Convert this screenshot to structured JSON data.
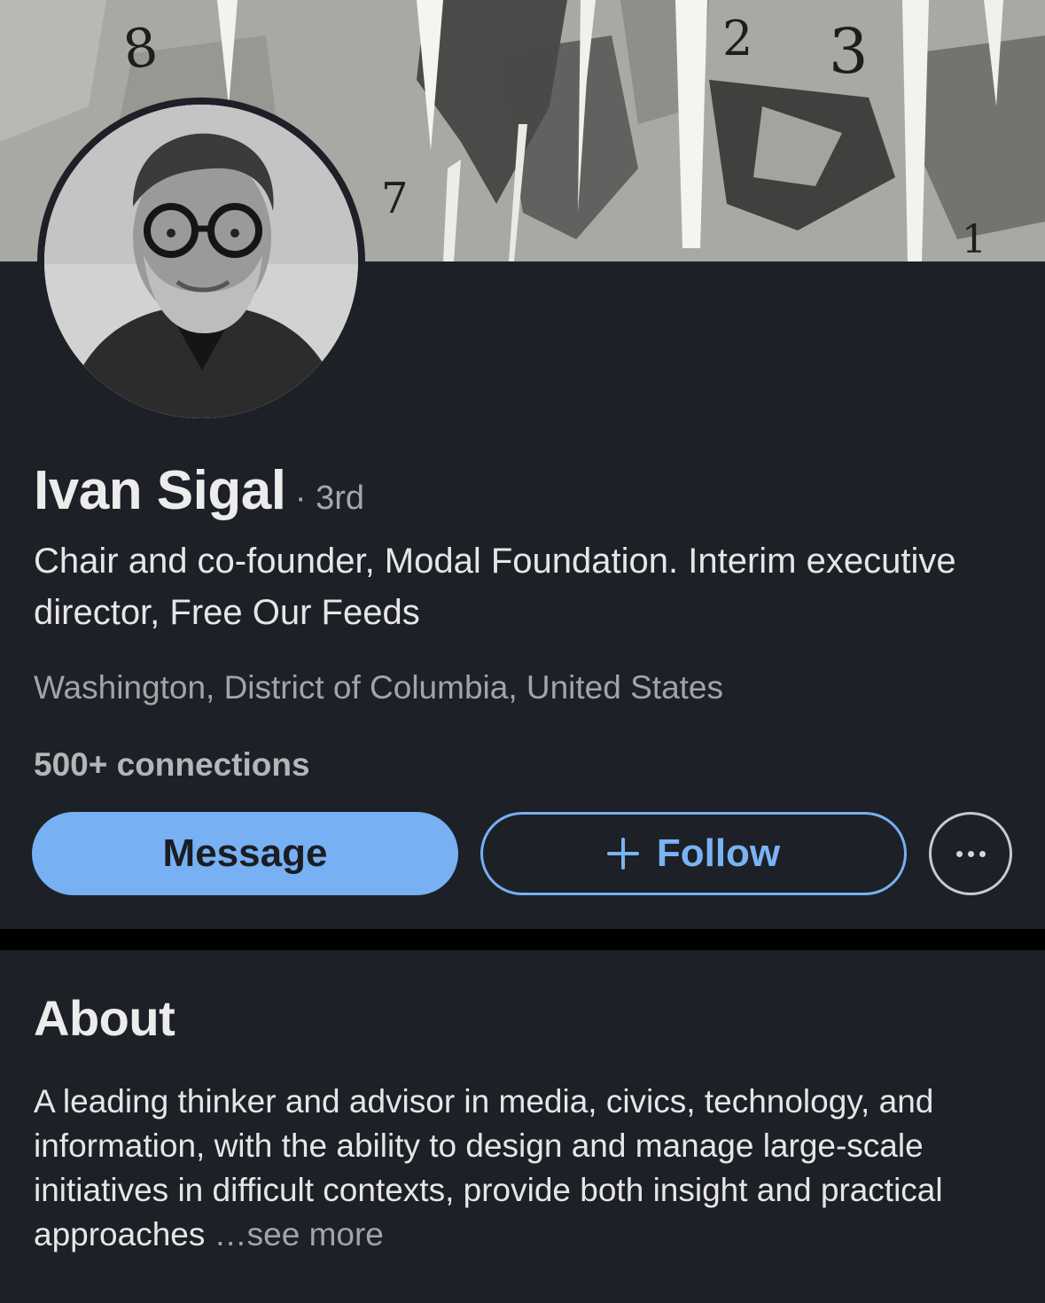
{
  "profile": {
    "name": "Ivan Sigal",
    "degree": "· 3rd",
    "headline": "Chair and co-founder, Modal Foundation. Interim executive director, Free Our Feeds",
    "location": "Washington, District of Columbia, United States",
    "connections": "500+ connections"
  },
  "banner": {
    "digits": [
      "8",
      "2",
      "3",
      "7",
      "1"
    ]
  },
  "actions": {
    "message_label": "Message",
    "follow_label": "Follow",
    "follow_icon": "plus-icon",
    "more_icon": "more-horizontal-icon"
  },
  "about": {
    "title": "About",
    "text": "A leading thinker and advisor in media, civics, technology, and information, with the ability to design and manage large-scale initiatives in difficult contexts, provide both insight and practical approaches",
    "see_more": "…see more"
  },
  "colors": {
    "background": "#1d2026",
    "accent": "#77b0f3",
    "secondary_text": "#a3a4a8"
  }
}
